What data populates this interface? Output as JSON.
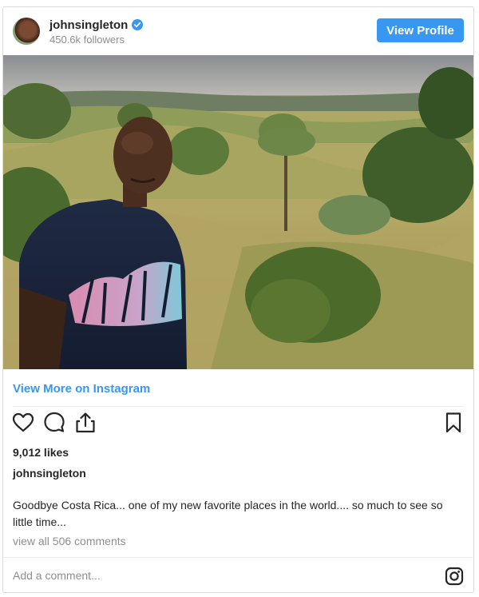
{
  "header": {
    "username": "johnsingleton",
    "followers": "450.6k followers",
    "view_profile_label": "View Profile"
  },
  "post": {
    "view_more_label": "View More on Instagram",
    "likes": "9,012 likes",
    "owner": "johnsingleton",
    "caption": "Goodbye Costa Rica... one of my new favorite places in the world.... so much to see so little time...",
    "comments_link": "view all 506 comments"
  },
  "comment_box": {
    "placeholder": "Add a comment..."
  },
  "colors": {
    "accent": "#3897f0",
    "muted_text": "#8e8e8e",
    "border": "#dbdbdb"
  },
  "icons": [
    "verified-badge-icon",
    "heart-icon",
    "comment-icon",
    "share-icon",
    "bookmark-icon",
    "instagram-icon"
  ]
}
